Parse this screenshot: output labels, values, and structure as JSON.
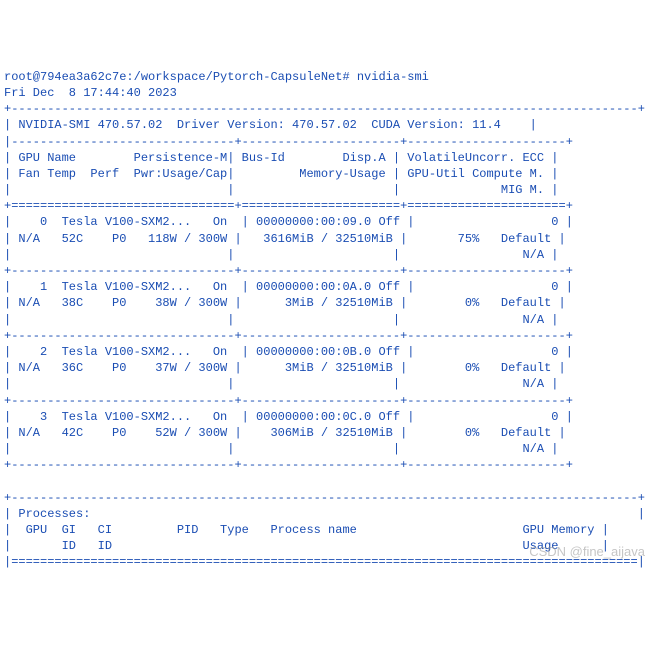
{
  "prompt": {
    "user_host": "root@794ea3a62c7e",
    "path": "/workspace/Pytorch-CapsuleNet",
    "command": "nvidia-smi"
  },
  "timestamp": "Fri Dec  8 17:44:40 2023",
  "header": {
    "smi_label": "NVIDIA-SMI",
    "smi_version": "470.57.02",
    "driver_label": "Driver Version:",
    "driver_version": "470.57.02",
    "cuda_label": "CUDA Version:",
    "cuda_version": "11.4"
  },
  "columns": {
    "line1": {
      "gpu": "GPU",
      "name": "Name",
      "persist": "Persistence-M",
      "bus": "Bus-Id",
      "disp": "Disp.A",
      "volatile": "Volatile",
      "uncorr": "Uncorr. ECC"
    },
    "line2": {
      "fan": "Fan",
      "temp": "Temp",
      "perf": "Perf",
      "pwr": "Pwr:Usage/Cap",
      "mem": "Memory-Usage",
      "util": "GPU-Util",
      "compute": "Compute M."
    },
    "line3": {
      "mig": "MIG M."
    }
  },
  "gpus": [
    {
      "idx": "0",
      "name": "Tesla V100-SXM2...",
      "persist": "On",
      "bus": "00000000:00:09.0",
      "disp": "Off",
      "ecc": "0",
      "fan": "N/A",
      "temp": "52C",
      "perf": "P0",
      "pwr_usage": "118W",
      "pwr_cap": "300W",
      "mem_used": "3616MiB",
      "mem_total": "32510MiB",
      "util": "75%",
      "compute": "Default",
      "mig": "N/A"
    },
    {
      "idx": "1",
      "name": "Tesla V100-SXM2...",
      "persist": "On",
      "bus": "00000000:00:0A.0",
      "disp": "Off",
      "ecc": "0",
      "fan": "N/A",
      "temp": "38C",
      "perf": "P0",
      "pwr_usage": "38W",
      "pwr_cap": "300W",
      "mem_used": "3MiB",
      "mem_total": "32510MiB",
      "util": "0%",
      "compute": "Default",
      "mig": "N/A"
    },
    {
      "idx": "2",
      "name": "Tesla V100-SXM2...",
      "persist": "On",
      "bus": "00000000:00:0B.0",
      "disp": "Off",
      "ecc": "0",
      "fan": "N/A",
      "temp": "36C",
      "perf": "P0",
      "pwr_usage": "37W",
      "pwr_cap": "300W",
      "mem_used": "3MiB",
      "mem_total": "32510MiB",
      "util": "0%",
      "compute": "Default",
      "mig": "N/A"
    },
    {
      "idx": "3",
      "name": "Tesla V100-SXM2...",
      "persist": "On",
      "bus": "00000000:00:0C.0",
      "disp": "Off",
      "ecc": "0",
      "fan": "N/A",
      "temp": "42C",
      "perf": "P0",
      "pwr_usage": "52W",
      "pwr_cap": "300W",
      "mem_used": "306MiB",
      "mem_total": "32510MiB",
      "util": "0%",
      "compute": "Default",
      "mig": "N/A"
    }
  ],
  "processes": {
    "title": "Processes:",
    "cols": {
      "gpu": "GPU",
      "gi": "GI",
      "ci": "CI",
      "pid": "PID",
      "type": "Type",
      "name": "Process name",
      "mem": "GPU Memory",
      "gi_id": "ID",
      "ci_id": "ID",
      "usage": "Usage"
    }
  },
  "watermark": "CSDN @fine_aijava"
}
